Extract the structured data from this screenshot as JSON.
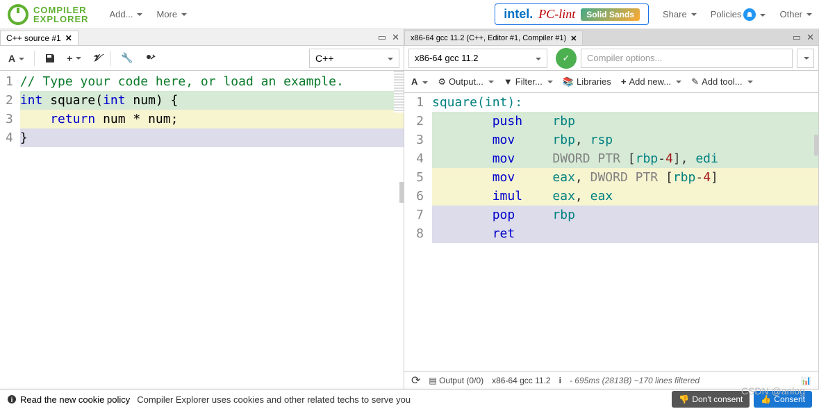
{
  "brand": {
    "line1": "COMPILER",
    "line2": "EXPLORER"
  },
  "nav": {
    "add": "Add...",
    "more": "More",
    "share": "Share",
    "policies": "Policies",
    "other": "Other"
  },
  "sponsors": {
    "intel": "intel.",
    "pclint": "PC-lint",
    "solid": "Solid Sands"
  },
  "left_pane": {
    "tab_title": "C++ source #1",
    "language": "C++",
    "code_lines": [
      {
        "n": 1,
        "type": "comment",
        "text": "// Type your code here, or load an example."
      },
      {
        "n": 2,
        "type": "sig",
        "kw": "int",
        "fn": "square",
        "params_kw": "int",
        "params_name": "num",
        "brace": "{",
        "hl": "green"
      },
      {
        "n": 3,
        "type": "ret",
        "kw": "return",
        "expr": "num * num;",
        "hl": "yellow"
      },
      {
        "n": 4,
        "type": "close",
        "text": "}",
        "hl": "blue"
      }
    ]
  },
  "right_pane": {
    "tab_title": "x86-64 gcc 11.2 (C++, Editor #1, Compiler #1)",
    "compiler": "x86-64 gcc 11.2",
    "options_placeholder": "Compiler options...",
    "toolbar": {
      "output": "Output...",
      "filter": "Filter...",
      "libraries": "Libraries",
      "addnew": "Add new...",
      "addtool": "Add tool..."
    },
    "asm_lines": [
      {
        "n": 1,
        "hl": "",
        "label": "square(int):"
      },
      {
        "n": 2,
        "hl": "green",
        "op": "push",
        "args": [
          [
            "reg",
            "rbp"
          ]
        ]
      },
      {
        "n": 3,
        "hl": "green",
        "op": "mov",
        "args": [
          [
            "reg",
            "rbp"
          ],
          [
            "punc",
            ", "
          ],
          [
            "reg",
            "rsp"
          ]
        ]
      },
      {
        "n": 4,
        "hl": "green",
        "op": "mov",
        "args": [
          [
            "dir",
            "DWORD PTR "
          ],
          [
            "punc",
            "["
          ],
          [
            "reg",
            "rbp"
          ],
          [
            "punc",
            "-"
          ],
          [
            "num",
            "4"
          ],
          [
            "punc",
            "], "
          ],
          [
            "reg",
            "edi"
          ]
        ]
      },
      {
        "n": 5,
        "hl": "yellow",
        "op": "mov",
        "args": [
          [
            "reg",
            "eax"
          ],
          [
            "punc",
            ", "
          ],
          [
            "dir",
            "DWORD PTR "
          ],
          [
            "punc",
            "["
          ],
          [
            "reg",
            "rbp"
          ],
          [
            "punc",
            "-"
          ],
          [
            "num",
            "4"
          ],
          [
            "punc",
            "]"
          ]
        ]
      },
      {
        "n": 6,
        "hl": "yellow",
        "op": "imul",
        "args": [
          [
            "reg",
            "eax"
          ],
          [
            "punc",
            ", "
          ],
          [
            "reg",
            "eax"
          ]
        ]
      },
      {
        "n": 7,
        "hl": "blue",
        "op": "pop",
        "args": [
          [
            "reg",
            "rbp"
          ]
        ]
      },
      {
        "n": 8,
        "hl": "blue",
        "op": "ret",
        "args": []
      }
    ],
    "bottom": {
      "output": "Output (0/0)",
      "compiler": "x86-64 gcc 11.2",
      "timing": "- 695ms (2813B) ~170 lines filtered"
    }
  },
  "cookie": {
    "read": "Read the new cookie policy",
    "msg": "Compiler Explorer uses cookies and other related techs to serve you",
    "noconsent": "Don't consent",
    "consent": "Consent"
  },
  "watermark": "CSDN @anlog"
}
